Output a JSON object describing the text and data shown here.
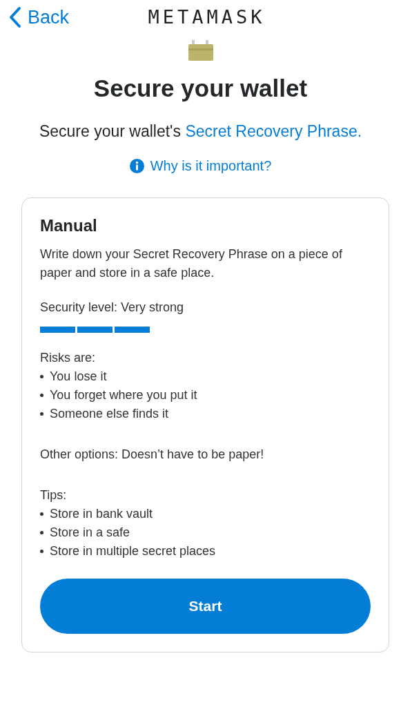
{
  "nav": {
    "back": "Back",
    "logo": "METAMASK"
  },
  "title": "Secure your wallet",
  "subtitle": {
    "text": "Secure your wallet's ",
    "link": "Secret Recovery Phrase."
  },
  "info_link": "Why is it important?",
  "card": {
    "title": "Manual",
    "description": "Write down your Secret Recovery Phrase on a piece of paper and store in a safe place.",
    "security": {
      "label": "Security level: Very strong",
      "bars": [
        {
          "filled": true
        },
        {
          "filled": true
        },
        {
          "filled": true
        }
      ]
    },
    "risks": {
      "heading": "Risks are:",
      "items": [
        "You lose it",
        "You forget where you put it",
        "Someone else finds it"
      ]
    },
    "other": "Other options: Doesn’t have to be paper!",
    "tips": {
      "heading": "Tips:",
      "items": [
        "Store in bank vault",
        "Store in a safe",
        "Store in multiple secret places"
      ]
    },
    "button": "Start"
  }
}
